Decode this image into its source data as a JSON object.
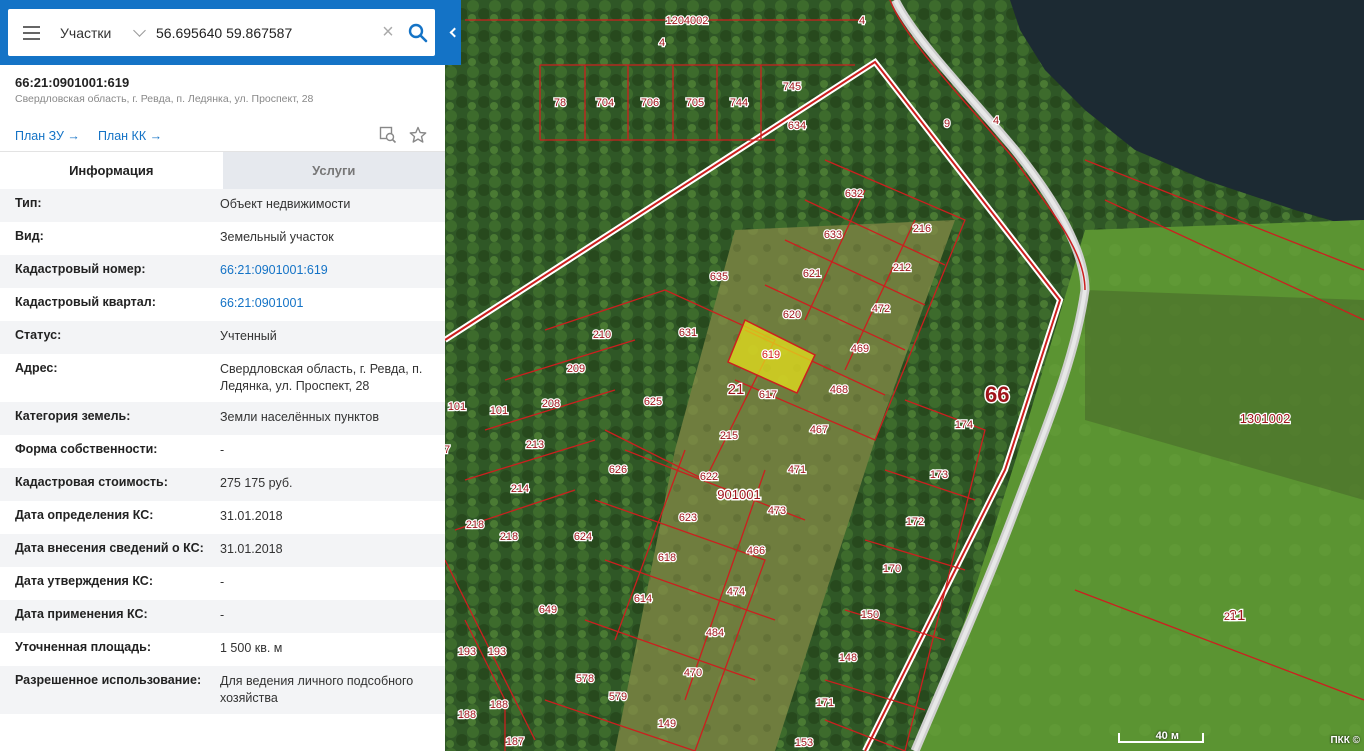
{
  "search": {
    "type_label": "Участки",
    "query": "56.695640 59.867587",
    "clear_label": "×"
  },
  "object": {
    "title": "66:21:0901001:619",
    "address": "Свердловская область, г. Ревда, п. Ледянка, ул. Проспект, 28"
  },
  "links": {
    "plan_zu": "План ЗУ →",
    "plan_kk": "План КК →"
  },
  "tabs": {
    "info": "Информация",
    "services": "Услуги"
  },
  "rows": [
    {
      "key": "Тип:",
      "value": "Объект недвижимости",
      "link": false
    },
    {
      "key": "Вид:",
      "value": "Земельный участок",
      "link": false
    },
    {
      "key": "Кадастровый номер:",
      "value": "66:21:0901001:619",
      "link": true
    },
    {
      "key": "Кадастровый квартал:",
      "value": "66:21:0901001",
      "link": true
    },
    {
      "key": "Статус:",
      "value": "Учтенный",
      "link": false
    },
    {
      "key": "Адрес:",
      "value": "Свердловская область, г. Ревда, п. Ледянка, ул. Проспект, 28",
      "link": false
    },
    {
      "key": "Категория земель:",
      "value": "Земли населённых пунктов",
      "link": false
    },
    {
      "key": "Форма собственности:",
      "value": "-",
      "link": false
    },
    {
      "key": "Кадастровая стоимость:",
      "value": "275 175 руб.",
      "link": false
    },
    {
      "key": "Дата определения КС:",
      "value": "31.01.2018",
      "link": false
    },
    {
      "key": "Дата внесения сведений о КС:",
      "value": "31.01.2018",
      "link": false
    },
    {
      "key": "Дата утверждения КС:",
      "value": "-",
      "link": false
    },
    {
      "key": "Дата применения КС:",
      "value": "-",
      "link": false
    },
    {
      "key": "Уточненная площадь:",
      "value": "1 500 кв. м",
      "link": false
    },
    {
      "key": "Разрешенное использование:",
      "value": "Для ведения личного подсобного хозяйства",
      "link": false
    }
  ],
  "map": {
    "parcel_labels": [
      "1204002",
      "4",
      "4",
      "78",
      "704",
      "706",
      "705",
      "744",
      "745",
      "634",
      "9",
      "4",
      "632",
      "216",
      "633",
      "212",
      "621",
      "635",
      "620",
      "472",
      "631",
      "619",
      "469",
      "210",
      "209",
      "21",
      "617",
      "468",
      "101",
      "101",
      "208",
      "625",
      "174",
      "215",
      "467",
      "213",
      "471",
      "173",
      "622",
      "901001",
      "214",
      "626",
      "473",
      "623",
      "172",
      "218",
      "218",
      "624",
      "466",
      "618",
      "170",
      "614",
      "474",
      "649",
      "150",
      "484",
      "193",
      "193",
      "148",
      "578",
      "470",
      "579",
      "171",
      "188",
      "188",
      "149",
      "187",
      "153",
      "66",
      "1301002",
      "21",
      "7"
    ],
    "selected_parcel": "619",
    "district_label": "66",
    "quarter_label": "901001",
    "scale_label": "40 м",
    "attribution": "ПКК ©",
    "colors": {
      "boundary": "#cc1f1f",
      "selected_fill": "#e6e01c",
      "forest": "#2f5a24",
      "field": "#4f8a2e",
      "water": "#1c2a33"
    }
  }
}
